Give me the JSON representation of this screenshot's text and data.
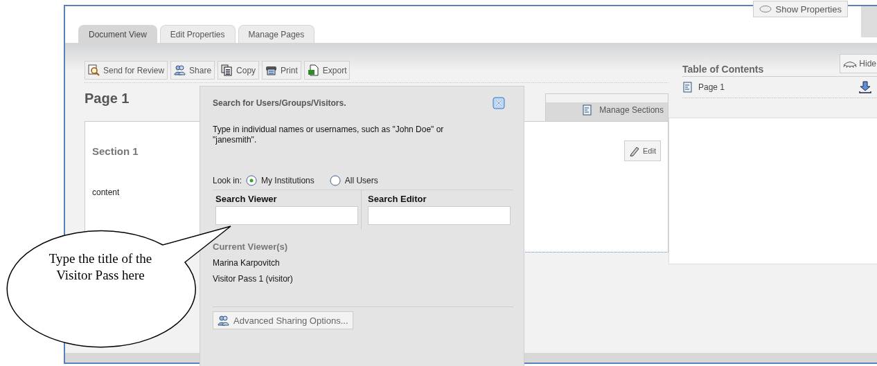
{
  "top_button": {
    "label": "Show Properties"
  },
  "tabs": [
    {
      "label": "Document View",
      "selected": true
    },
    {
      "label": "Edit Properties",
      "selected": false
    },
    {
      "label": "Manage Pages",
      "selected": false
    }
  ],
  "toolbar": [
    {
      "label": "Send for Review"
    },
    {
      "label": "Share"
    },
    {
      "label": "Copy"
    },
    {
      "label": "Print"
    },
    {
      "label": "Export"
    }
  ],
  "page": {
    "title": "Page 1",
    "manage_sections": "Manage Sections",
    "section_title": "Section 1",
    "content": "content",
    "edit_button": "Edit"
  },
  "toc": {
    "title": "Table of Contents",
    "hide_button": "Hide",
    "items": [
      {
        "label": "Page 1"
      }
    ]
  },
  "share_popup": {
    "title": "Search for Users/Groups/Visitors.",
    "instructions": "Type in individual names or usernames, such as \"John Doe\" or \"janesmith\".",
    "look_in_label": "Look in:",
    "scopes": [
      {
        "label": "My Institutions",
        "selected": true
      },
      {
        "label": "All Users",
        "selected": false
      }
    ],
    "search_viewer": {
      "label": "Search Viewer"
    },
    "search_editor": {
      "label": "Search Editor"
    },
    "current_viewers_title": "Current Viewer(s)",
    "current_viewers": [
      "Marina Karpovitch",
      "Visitor Pass 1 (visitor)"
    ],
    "advanced_button": "Advanced Sharing Options..."
  },
  "callout": {
    "text": "Type the title of the Visitor Pass here"
  }
}
